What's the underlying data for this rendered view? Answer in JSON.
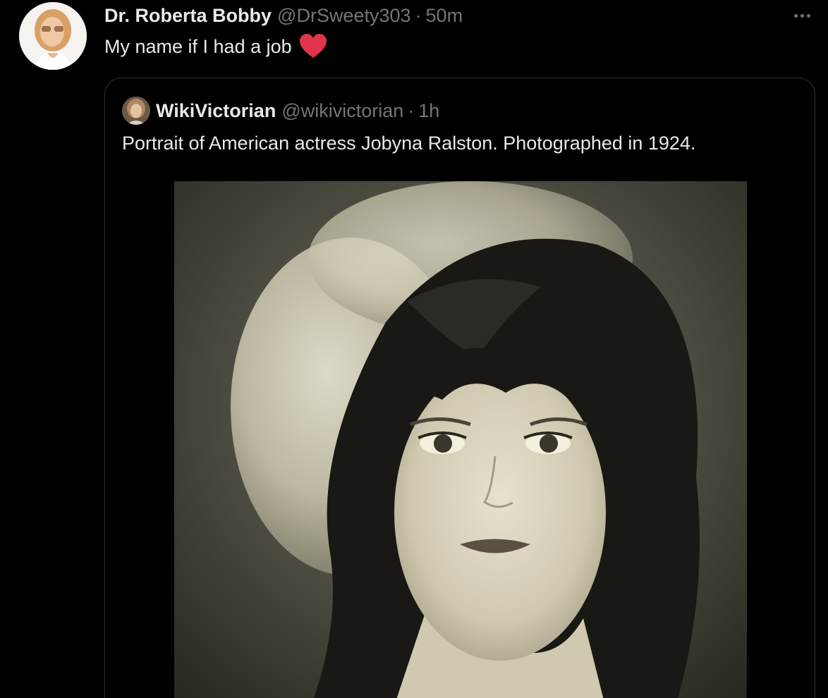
{
  "tweet": {
    "author_name": "Dr. Roberta Bobby",
    "author_handle": "@DrSweety303",
    "separator": "·",
    "time": "50m",
    "text": "My name if I had a job",
    "heart_icon": "red-heart-emoji",
    "more_icon": "more-options-icon",
    "colors": {
      "background": "#000000",
      "primary_text": "#e7e9ea",
      "secondary_text": "#71767b",
      "heart": "#e0344a",
      "border": "#2f3336"
    }
  },
  "quoted_tweet": {
    "author_name": "WikiVictorian",
    "author_handle": "@wikivictorian",
    "separator": "·",
    "time": "1h",
    "text": "Portrait of American actress Jobyna Ralston. Photographed in 1924."
  }
}
